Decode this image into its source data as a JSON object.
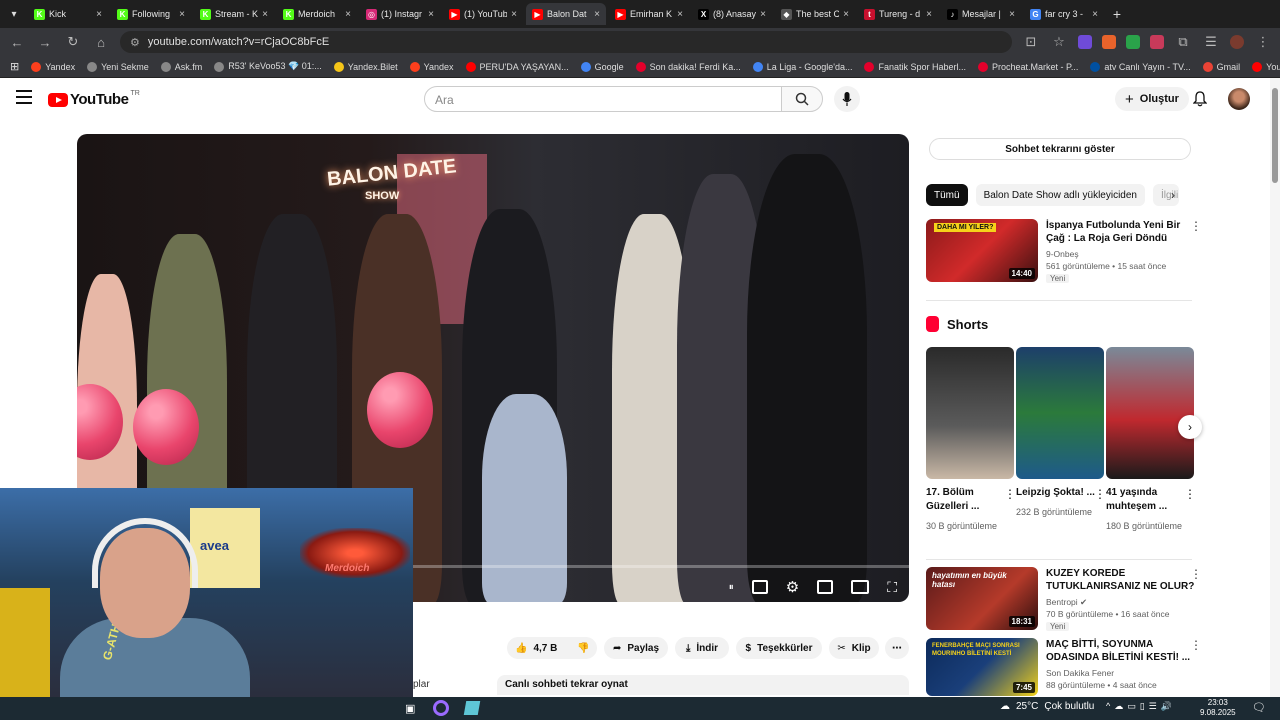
{
  "browser": {
    "tabs": [
      {
        "title": "Kick",
        "fav_color": "#53fc18",
        "fav_letter": "K"
      },
      {
        "title": "Following",
        "fav_color": "#53fc18",
        "fav_letter": "K"
      },
      {
        "title": "Stream - K",
        "fav_color": "#53fc18",
        "fav_letter": "K"
      },
      {
        "title": "Merdoich",
        "fav_color": "#53fc18",
        "fav_letter": "K"
      },
      {
        "title": "(1) Instagr",
        "fav_color": "#d62976",
        "fav_letter": "◎"
      },
      {
        "title": "(1) YouTub",
        "fav_color": "#ff0000",
        "fav_letter": "▶"
      },
      {
        "title": "Balon Dat",
        "fav_color": "#ff0000",
        "fav_letter": "▶"
      },
      {
        "title": "Emirhan K",
        "fav_color": "#ff0000",
        "fav_letter": "▶"
      },
      {
        "title": "(8) Anasay",
        "fav_color": "#000000",
        "fav_letter": "X"
      },
      {
        "title": "The best C",
        "fav_color": "#555555",
        "fav_letter": "◆"
      },
      {
        "title": "Tureng - d",
        "fav_color": "#c8102e",
        "fav_letter": "t"
      },
      {
        "title": "Mesajlar |",
        "fav_color": "#000000",
        "fav_letter": "♪"
      },
      {
        "title": "far cry 3 -",
        "fav_color": "#4285f4",
        "fav_letter": "G"
      }
    ],
    "active_tab": 6,
    "url": "youtube.com/watch?v=rCjaOC8bFcE",
    "bookmarks": [
      {
        "label": "Yandex",
        "color": "#fc3f1d"
      },
      {
        "label": "Yeni Sekme",
        "color": "#888888"
      },
      {
        "label": "Ask.fm",
        "color": "#888888"
      },
      {
        "label": "R53' KeVoo53 💎 01:...",
        "color": "#888888"
      },
      {
        "label": "Yandex.Bilet",
        "color": "#f5c518"
      },
      {
        "label": "Yandex",
        "color": "#fc3f1d"
      },
      {
        "label": "PERU'DA YAŞAYAN...",
        "color": "#ff0000"
      },
      {
        "label": "Google",
        "color": "#4285f4"
      },
      {
        "label": "Son dakika! Ferdi Ka...",
        "color": "#e4002b"
      },
      {
        "label": "La Liga - Google'da...",
        "color": "#4285f4"
      },
      {
        "label": "Fanatik Spor Haberl...",
        "color": "#e4002b"
      },
      {
        "label": "Procheat.Market - P...",
        "color": "#e4002b"
      },
      {
        "label": "atv Canlı Yayın - TV...",
        "color": "#0050a0"
      },
      {
        "label": "Gmail",
        "color": "#ea4335"
      },
      {
        "label": "YouTube",
        "color": "#ff0000"
      }
    ]
  },
  "youtube": {
    "logo_text": "YouTube",
    "logo_country": "TR",
    "search_placeholder": "Ara",
    "create_label": "Oluştur",
    "video": {
      "sign_text": "BALON DATE",
      "sign_sub": "SHOW",
      "actions": {
        "likes": "4,7 B",
        "share": "Paylaş",
        "download": "İndir",
        "thanks": "Teşekkürler",
        "clip": "Klip"
      },
      "chat_replay_bottom": "Canlı sohbeti tekrar oynat",
      "partial_text": "plar"
    },
    "cam": {
      "neon_text": "Merdoich",
      "poster_text": "avea",
      "shirt_text": "G-ATHL"
    },
    "sidebar": {
      "chat_replay": "Sohbet tekrarını göster",
      "chips": [
        "Tümü",
        "Balon Date Show adlı yükleyiciden",
        "İlgili"
      ],
      "rec1": {
        "title": "İspanya Futbolunda Yeni Bir Çağ : La Roja Geri Döndü",
        "channel": "9-Onbeş",
        "meta": "561 görüntüleme • 15 saat önce",
        "badge": "Yeni",
        "duration": "14:40",
        "thumb_text": "DAHA MI YILER?"
      },
      "shorts_title": "Shorts",
      "shorts": [
        {
          "title": "17. Bölüm Güzelleri ...",
          "views": "30 B görüntüleme"
        },
        {
          "title": "Leipzig Şokta! ...",
          "views": "232 B görüntüleme"
        },
        {
          "title": "41 yaşında muhteşem ...",
          "views": "180 B görüntüleme"
        }
      ],
      "rec2": {
        "title": "KUZEY KOREDE TUTUKLANIRSANIZ NE OLUR?",
        "channel": "Bentropi",
        "meta": "70 B görüntüleme • 16 saat önce",
        "badge": "Yeni",
        "duration": "18:31",
        "thumb_text": "hayatımın en büyük hatası"
      },
      "rec3": {
        "title": "MAÇ BİTTİ, SOYUNMA ODASINDA BİLETİNİ KESTİ! ...",
        "channel": "Son Dakika Fener",
        "meta": "88 görüntüleme • 4 saat önce",
        "duration": "7:45",
        "thumb_text": "FENERBAHÇE MAÇI SONRASI MOURINHO BİLETİNİ KESTİ"
      }
    }
  },
  "taskbar": {
    "weather": "25°C",
    "weather_desc": "Çok bulutlu",
    "time": "23:03",
    "date": "9.08.2025"
  }
}
